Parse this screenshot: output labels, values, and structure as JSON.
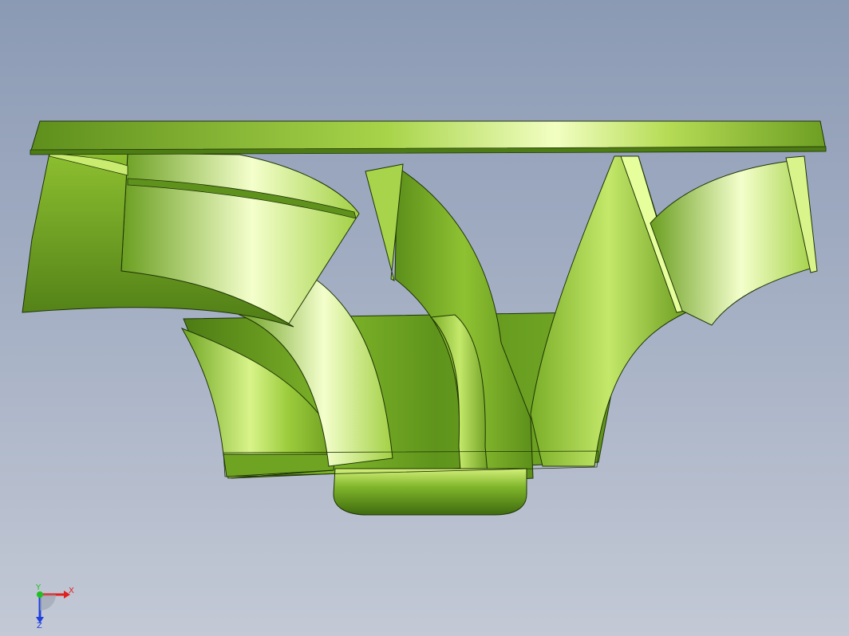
{
  "viewport": {
    "background_top": "#8b9ab4",
    "background_bottom": "#c3c9d5"
  },
  "model": {
    "part_type": "impeller",
    "base_color": "#7fb52a",
    "highlight_color": "#f0ffb0",
    "shadow_color": "#3f6a10",
    "edge_color": "#1e3306"
  },
  "triad": {
    "x_label": "X",
    "y_label": "Y",
    "z_label": "Z",
    "x_color": "#e02020",
    "y_color": "#20c020",
    "z_color": "#2040e0"
  }
}
